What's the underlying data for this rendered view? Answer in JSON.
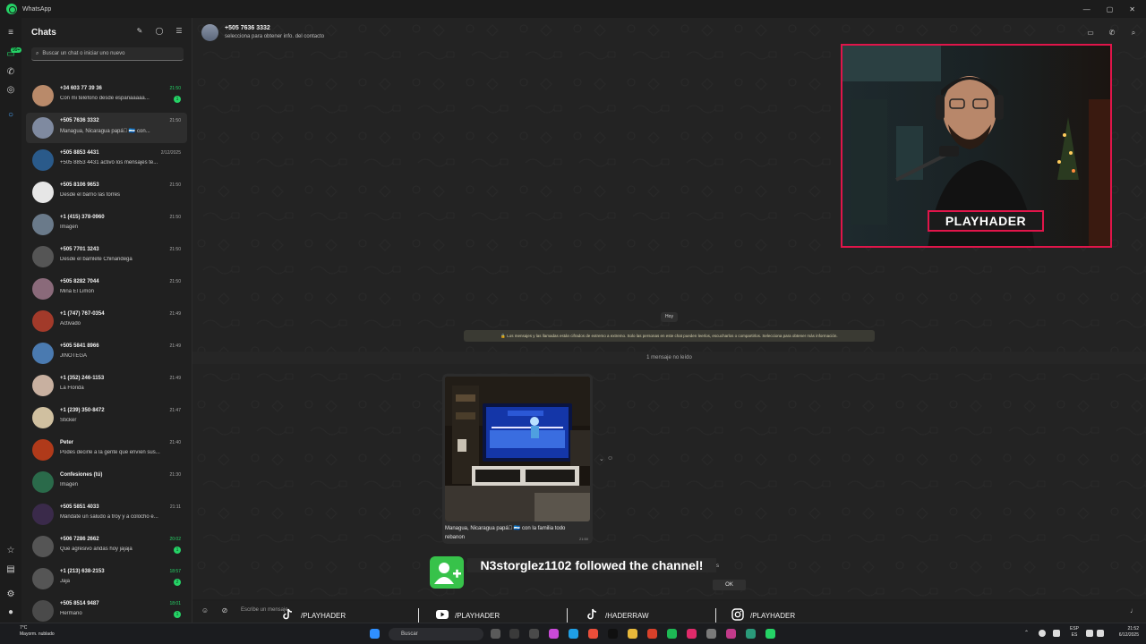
{
  "window": {
    "title": "WhatsApp",
    "minimize": "—",
    "maximize": "▢",
    "close": "✕"
  },
  "sidebar": {
    "title": "Chats",
    "search_placeholder": "Buscar un chat o iniciar uno nuevo",
    "rail_badge": "99+",
    "chats": [
      {
        "name": "+34 603 77 39 36",
        "time": "21:50",
        "time_green": true,
        "msg": "Con mi teléfono desde españaaaaa...",
        "badge": "1"
      },
      {
        "name": "+505 7636 3332",
        "time": "21:50",
        "time_green": false,
        "msg": "Managua, Nicaragua papá🏻 🇳🇮 con...",
        "badge": "",
        "active": true
      },
      {
        "name": "+505 8853 4431",
        "time": "2/12/2025",
        "time_green": false,
        "msg": "+505 8853 4431 activó los mensajes te...",
        "badge": ""
      },
      {
        "name": "+505 8106 9653",
        "time": "21:50",
        "time_green": false,
        "msg": "Desde el barrio las torres",
        "badge": ""
      },
      {
        "name": "+1 (415) 378-0960",
        "time": "21:50",
        "time_green": false,
        "msg": "Imagen",
        "badge": ""
      },
      {
        "name": "+505 7701 3243",
        "time": "21:50",
        "time_green": false,
        "msg": "Desde el bamlete Chinandega",
        "badge": ""
      },
      {
        "name": "+505 8282 7044",
        "time": "21:50",
        "time_green": false,
        "msg": "Mina El Limón",
        "badge": ""
      },
      {
        "name": "+1 (747) 767-0354",
        "time": "21:49",
        "time_green": false,
        "msg": "Activado",
        "badge": ""
      },
      {
        "name": "+505 5841 8966",
        "time": "21:49",
        "time_green": false,
        "msg": "JINOTEGA",
        "badge": ""
      },
      {
        "name": "+1 (352) 246-1153",
        "time": "21:49",
        "time_green": false,
        "msg": "La Florida",
        "badge": ""
      },
      {
        "name": "+1 (239) 350-8472",
        "time": "21:47",
        "time_green": false,
        "msg": "Sticker",
        "badge": ""
      },
      {
        "name": "Peter",
        "time": "21:40",
        "time_green": false,
        "msg": "Podes decirle a la gente que envíen sus...",
        "badge": ""
      },
      {
        "name": "Confesiones (tú)",
        "time": "21:30",
        "time_green": false,
        "msg": "Imagen",
        "badge": ""
      },
      {
        "name": "+505 5851 4033",
        "time": "21:11",
        "time_green": false,
        "msg": "Mándate un saludo a troy y a colocho e...",
        "badge": ""
      },
      {
        "name": "+506 7286 2662",
        "time": "20:02",
        "time_green": true,
        "msg": "Que agresivo andas hoy jajaja",
        "badge": "1"
      },
      {
        "name": "+1 (213) 638-2153",
        "time": "18:57",
        "time_green": true,
        "msg": "Jaja",
        "badge": "2"
      },
      {
        "name": "+505 8514 9487",
        "time": "18:01",
        "time_green": true,
        "msg": "Hermano",
        "badge": "1"
      }
    ]
  },
  "conversation": {
    "contact_name": "+505 7636 3332",
    "contact_sub": "selecciona para obtener info. del contacto",
    "day_label": "Hoy",
    "encryption_notice": "🔒 Los mensajes y las llamadas están cifrados de extremo a extremo. Solo las personas en este chat pueden leerlos, escucharlos o compartirlos. Selecciona para obtener más información.",
    "unread_label": "1 mensaje no leído",
    "message": {
      "caption": "Managua, Nicaragua papá🏻 🇳🇮 con la familia todo rebanon",
      "time": "21:50"
    },
    "input_placeholder": "Escribe un mensaje"
  },
  "overlay": {
    "cam_label": "PLAYHADER",
    "follow_text": "N3storglez1102 followed the channel!",
    "ok_label": "OK",
    "ghost_text": "s",
    "socials": [
      {
        "platform": "tiktok",
        "handle": "/PLAYHADER"
      },
      {
        "platform": "youtube",
        "handle": "/PLAYHADER"
      },
      {
        "platform": "tiktok",
        "handle": "/HADERRAW"
      },
      {
        "platform": "instagram",
        "handle": "/PLAYHADER"
      }
    ]
  },
  "taskbar": {
    "weather_temp": "7°C",
    "weather_desc": "Mayorm. nublado",
    "search_label": "Buscar",
    "lang_top": "ESP",
    "lang_bottom": "ES",
    "time": "21:52",
    "date": "6/12/2025"
  },
  "colors": {
    "accent": "#25d366",
    "overlay_red": "#e0154a",
    "follow_green": "#37c24a"
  }
}
